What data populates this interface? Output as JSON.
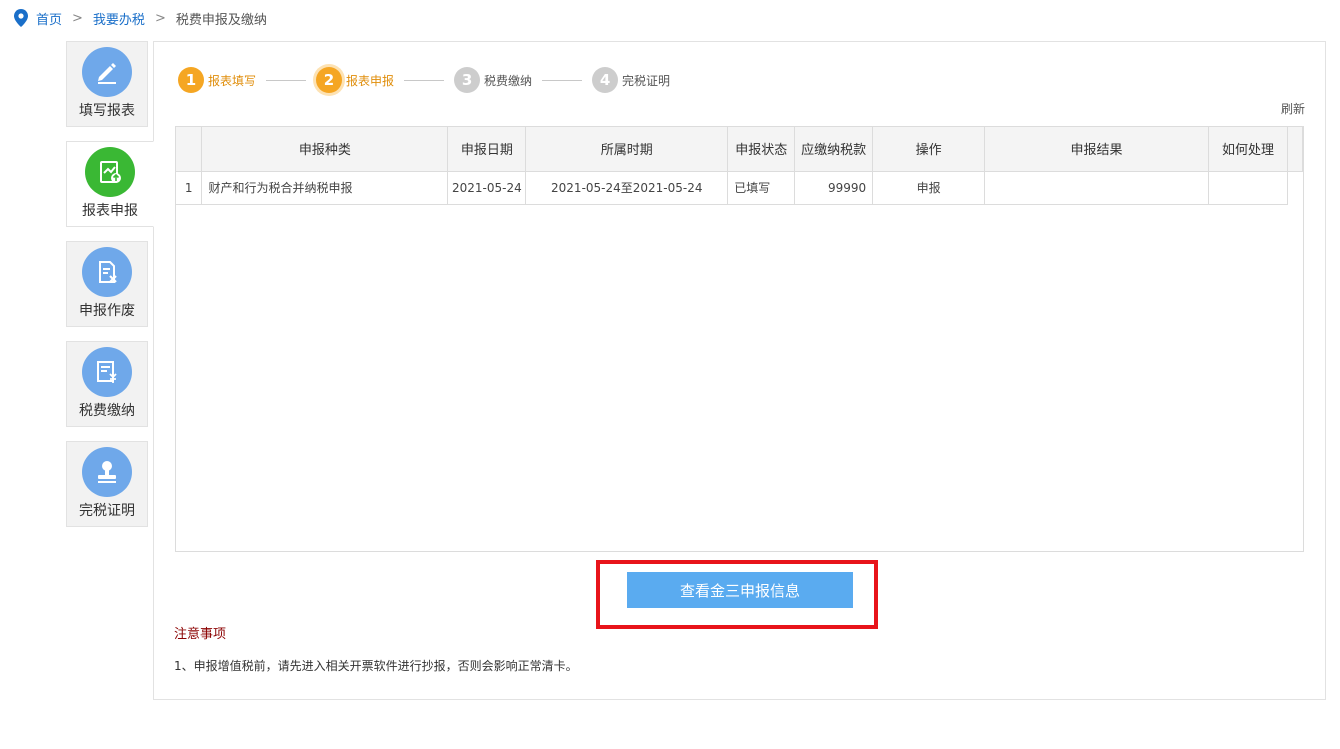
{
  "breadcrumb": {
    "home": "首页",
    "sep1": ">",
    "tax": "我要办税",
    "sep2": ">",
    "current": "税费申报及缴纳"
  },
  "sidenav": [
    {
      "label": "填写报表",
      "icon": "pen-icon"
    },
    {
      "label": "报表申报",
      "icon": "upload-report-icon",
      "active": true
    },
    {
      "label": "申报作废",
      "icon": "void-document-icon"
    },
    {
      "label": "税费缴纳",
      "icon": "payment-icon"
    },
    {
      "label": "完税证明",
      "icon": "stamp-icon"
    }
  ],
  "stepper": [
    {
      "num": "1",
      "label": "报表填写",
      "state": "done"
    },
    {
      "num": "2",
      "label": "报表申报",
      "state": "current"
    },
    {
      "num": "3",
      "label": "税费缴纳",
      "state": "todo"
    },
    {
      "num": "4",
      "label": "完税证明",
      "state": "todo"
    }
  ],
  "refresh_label": "刷新",
  "table": {
    "headers": [
      "",
      "申报种类",
      "申报日期",
      "所属时期",
      "申报状态",
      "应缴纳税款",
      "操作",
      "申报结果",
      "如何处理"
    ],
    "rows": [
      {
        "idx": "1",
        "type": "财产和行为税合并纳税申报",
        "date": "2021-05-24",
        "period": "2021-05-24至2021-05-24",
        "status": "已填写",
        "amount": "99990",
        "action": "申报",
        "result": "",
        "howto": ""
      }
    ]
  },
  "view_button_label": "查看金三申报信息",
  "notice": {
    "title": "注意事项",
    "text": "1、申报增值税前，请先进入相关开票软件进行抄报，否则会影响正常清卡。"
  },
  "colors": {
    "accent": "#5aabf0",
    "step_active": "#f5a623",
    "nav_active": "#3ab834",
    "nav_icon": "#6fa8ea",
    "highlight": "#e8141a"
  }
}
